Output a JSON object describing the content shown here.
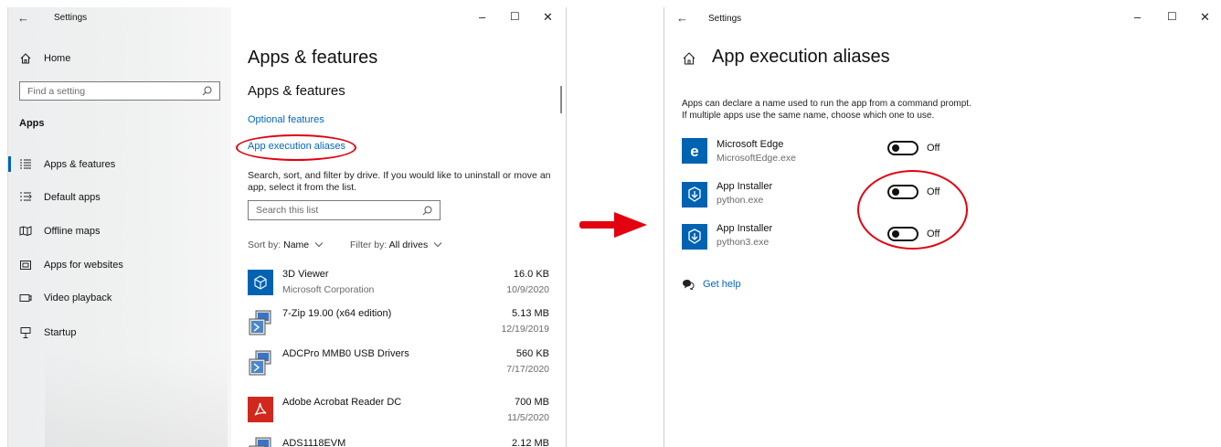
{
  "left": {
    "titlebar": {
      "back": "←",
      "title": "Settings",
      "minimize": "–",
      "maximize": "☐",
      "close": "✕"
    },
    "nav": {
      "home": "Home",
      "search_placeholder": "Find a setting",
      "section": "Apps",
      "items": [
        {
          "label": "Apps & features",
          "icon": "apps-features-icon",
          "active": true
        },
        {
          "label": "Default apps",
          "icon": "default-apps-icon"
        },
        {
          "label": "Offline maps",
          "icon": "offline-maps-icon"
        },
        {
          "label": "Apps for websites",
          "icon": "apps-for-websites-icon"
        },
        {
          "label": "Video playback",
          "icon": "video-playback-icon"
        },
        {
          "label": "Startup",
          "icon": "startup-icon"
        }
      ]
    },
    "main": {
      "page_title": "Apps & features",
      "section_title": "Apps & features",
      "optional_features": "Optional features",
      "app_execution_aliases": "App execution aliases",
      "description": "Search, sort, and filter by drive. If you would like to uninstall or move an app, select it from the list.",
      "search_placeholder": "Search this list",
      "sort_label": "Sort by:",
      "sort_value": "Name",
      "filter_label": "Filter by:",
      "filter_value": "All drives",
      "apps": [
        {
          "name": "3D Viewer",
          "publisher": "Microsoft Corporation",
          "size": "16.0 KB",
          "date": "10/9/2020",
          "icon": "3d-viewer-icon"
        },
        {
          "name": "7-Zip 19.00 (x64 edition)",
          "publisher": "",
          "size": "5.13 MB",
          "date": "12/19/2019",
          "icon": "installer-icon"
        },
        {
          "name": "ADCPro MMB0 USB Drivers",
          "publisher": "",
          "size": "560 KB",
          "date": "7/17/2020",
          "icon": "installer-icon"
        },
        {
          "name": "Adobe Acrobat Reader DC",
          "publisher": "",
          "size": "700 MB",
          "date": "11/5/2020",
          "icon": "acrobat-icon"
        },
        {
          "name": "ADS1118EVM",
          "publisher": "",
          "size": "2.12 MB",
          "date": "",
          "icon": "installer-icon"
        }
      ]
    }
  },
  "right": {
    "titlebar": {
      "back": "←",
      "title": "Settings",
      "minimize": "–",
      "maximize": "☐",
      "close": "✕"
    },
    "page_title": "App execution aliases",
    "description_line1": "Apps can declare a name used to run the app from a command prompt.",
    "description_line2": "If multiple apps use the same name, choose which one to use.",
    "aliases": [
      {
        "name": "Microsoft Edge",
        "exe": "MicrosoftEdge.exe",
        "state": "Off",
        "icon": "edge-icon"
      },
      {
        "name": "App Installer",
        "exe": "python.exe",
        "state": "Off",
        "icon": "app-installer-icon"
      },
      {
        "name": "App Installer",
        "exe": "python3.exe",
        "state": "Off",
        "icon": "app-installer-icon"
      }
    ],
    "get_help": "Get help"
  },
  "colors": {
    "accent": "#0063b1",
    "link": "#0067c0",
    "annotation_red": "#e3000f"
  }
}
